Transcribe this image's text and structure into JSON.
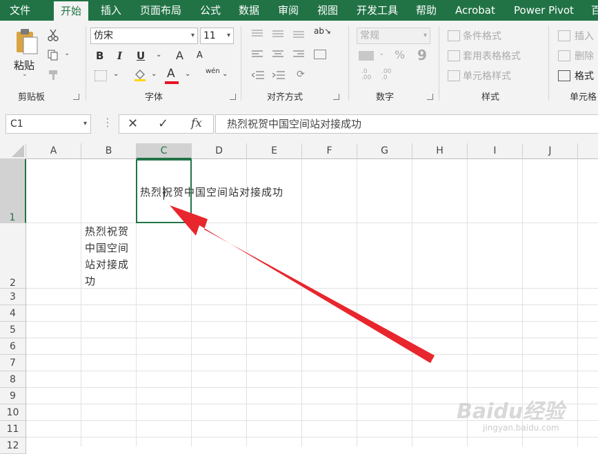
{
  "menu": {
    "tabs": [
      {
        "label": "文件",
        "active": false
      },
      {
        "label": "开始",
        "active": true
      },
      {
        "label": "插入",
        "active": false
      },
      {
        "label": "页面布局",
        "active": false
      },
      {
        "label": "公式",
        "active": false
      },
      {
        "label": "数据",
        "active": false
      },
      {
        "label": "审阅",
        "active": false
      },
      {
        "label": "视图",
        "active": false
      },
      {
        "label": "开发工具",
        "active": false
      },
      {
        "label": "帮助",
        "active": false
      },
      {
        "label": "Acrobat",
        "active": false
      },
      {
        "label": "Power Pivot",
        "active": false
      },
      {
        "label": "百",
        "active": false
      }
    ]
  },
  "ribbon": {
    "clipboard": {
      "paste_label": "粘贴",
      "group_label": "剪贴板"
    },
    "font": {
      "font_name": "仿宋",
      "font_size": "11",
      "bold": "B",
      "italic": "I",
      "underline": "U",
      "grow": "A",
      "shrink": "A",
      "font_color": "A",
      "font_color_hex": "#e81123",
      "phonetic": "wén",
      "group_label": "字体"
    },
    "alignment": {
      "group_label": "对齐方式"
    },
    "number": {
      "format": "常规",
      "percent": "%",
      "comma": "9",
      "group_label": "数字"
    },
    "styles": {
      "conditional": "条件格式",
      "table": "套用表格格式",
      "cell_style": "单元格样式",
      "group_label": "样式"
    },
    "cells": {
      "insert": "插入",
      "delete": "删除",
      "format": "格式",
      "group_label": "单元格"
    }
  },
  "formula_bar": {
    "name_box": "C1",
    "cancel": "✕",
    "enter": "✓",
    "fx": "fx",
    "content": "热烈祝贺中国空间站对接成功"
  },
  "sheet": {
    "columns": [
      "A",
      "B",
      "C",
      "D",
      "E",
      "F",
      "G",
      "H",
      "I",
      "J"
    ],
    "selected_column": "C",
    "rows": [
      "1",
      "2",
      "3",
      "4",
      "5",
      "6",
      "7",
      "8",
      "9",
      "10",
      "11",
      "12"
    ],
    "selected_row": "1",
    "cells": {
      "C1": "热烈祝贺中国空间站对接成功",
      "B2_lines": [
        "热烈祝贺",
        "中国空间",
        "站对接成",
        "功"
      ]
    }
  },
  "colors": {
    "accent": "#217346",
    "arrow": "#e8262d"
  },
  "watermark": {
    "text": "Baidu经验",
    "sub": "jingyan.baidu.com"
  }
}
